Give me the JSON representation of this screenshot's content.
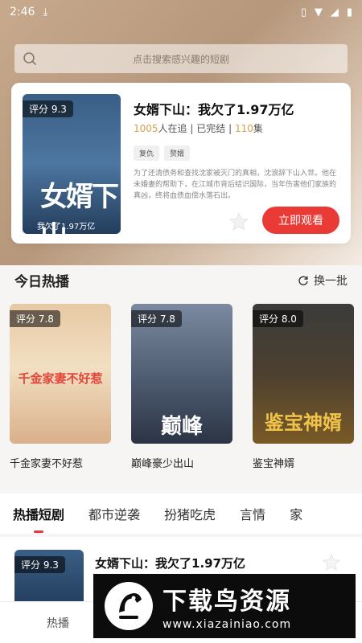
{
  "status_bar": {
    "time": "2:46"
  },
  "search": {
    "placeholder": "点击搜索感兴趣的短剧"
  },
  "featured": {
    "score": "评分 9.3",
    "poster_title": "女婿下山",
    "poster_subtitle": "我欠了1.97万亿",
    "title": "女婿下山：我欠了1.97万亿",
    "followers": "1005",
    "followers_suffix": "人在追",
    "status": "已完结",
    "episodes": "110",
    "episodes_suffix": "集",
    "tags": [
      "复仇",
      "赘婿"
    ],
    "description": "为了还清债务和查找沈家被灭门的真相，沈浪辞下山入世。他在未婚妻的帮助下，在江城市背后结识国际，当年伤害他们家族的真凶，终将血债血偿水落石出。",
    "watch_label": "立即观看"
  },
  "hot_section": {
    "title": "今日热播",
    "refresh_label": "换一批",
    "items": [
      {
        "score": "评分 7.8",
        "poster_text": "千金家妻不好惹",
        "title": "千金家妻不好惹"
      },
      {
        "score": "评分 7.8",
        "poster_text": "巅峰",
        "title": "巅峰豪少出山"
      },
      {
        "score": "评分 8.0",
        "poster_text": "鉴宝神婿",
        "title": "鉴宝神婿"
      }
    ]
  },
  "tabs": [
    "热播短剧",
    "都市逆袭",
    "扮猪吃虎",
    "言情",
    "家"
  ],
  "list": [
    {
      "score": "评分 9.3",
      "title": "女婿下山：我欠了1.97万亿"
    }
  ],
  "bottom_nav": {
    "hot_label": "热播"
  },
  "watermark": {
    "big": "下载鸟资源",
    "small": "www.xiazainiao.com"
  },
  "colors": {
    "accent": "#e93a36",
    "highlight": "#d4a04a"
  }
}
